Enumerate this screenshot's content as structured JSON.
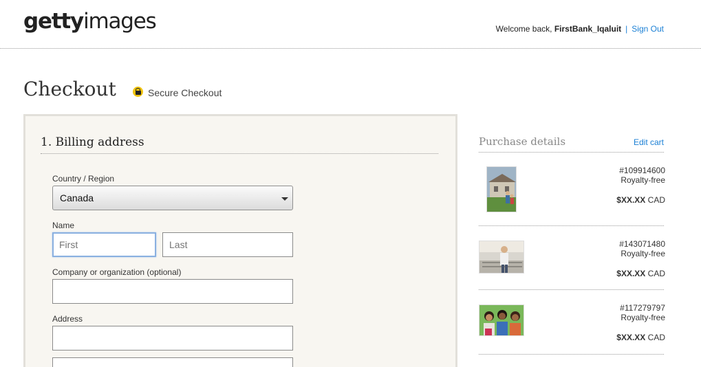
{
  "header": {
    "logo_bold": "getty",
    "logo_light": "images",
    "welcome_prefix": "Welcome back, ",
    "username": "FirstBank_Iqaluit",
    "separator": "|",
    "sign_out": "Sign Out"
  },
  "page": {
    "title": "Checkout",
    "secure_label": "Secure Checkout"
  },
  "billing": {
    "section_title": "1. Billing address",
    "country_label": "Country / Region",
    "country_value": "Canada",
    "name_label": "Name",
    "first_placeholder": "First",
    "last_placeholder": "Last",
    "company_label": "Company or organization (optional)",
    "address_label": "Address"
  },
  "purchase": {
    "title": "Purchase details",
    "edit_cart": "Edit cart",
    "items": [
      {
        "id": "#109914600",
        "license": "Royalty-free",
        "price": "$XX.XX",
        "currency": "CAD"
      },
      {
        "id": "#143071480",
        "license": "Royalty-free",
        "price": "$XX.XX",
        "currency": "CAD"
      },
      {
        "id": "#117279797",
        "license": "Royalty-free",
        "price": "$XX.XX",
        "currency": "CAD"
      }
    ]
  },
  "colors": {
    "link": "#1a7fd4",
    "panel_bg": "#f8f6f1",
    "lock": "#f1c40f"
  }
}
